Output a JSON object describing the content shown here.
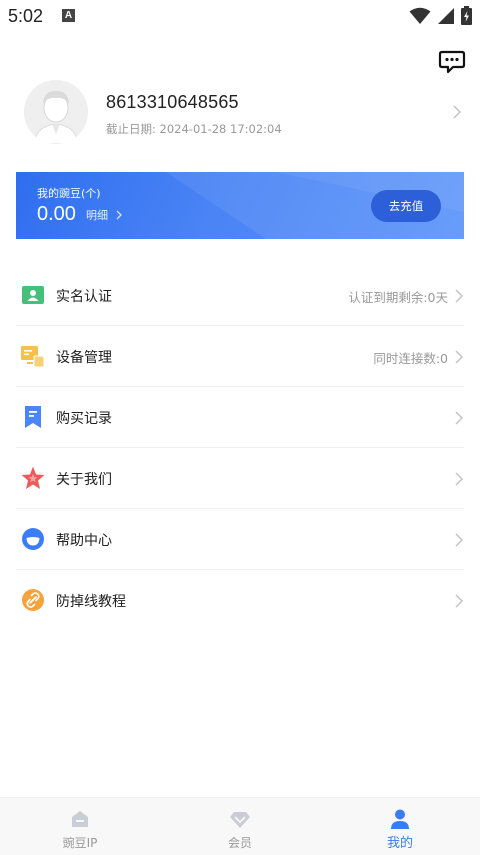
{
  "status": {
    "time": "5:02",
    "notification_icon_letter": "A"
  },
  "header": {
    "chat_icon": "chat-bubble-icon"
  },
  "profile": {
    "phone": "8613310648565",
    "expiry_label": "截止日期:",
    "expiry_value": "2024-01-28 17:02:04"
  },
  "bean_card": {
    "label": "我的豌豆(个)",
    "amount": "0.00",
    "detail_label": "明细",
    "recharge_label": "去充值"
  },
  "menu": {
    "items": [
      {
        "label": "实名认证",
        "value": "认证到期剩余:0天",
        "icon": "id-card-icon",
        "color": "#45c07a"
      },
      {
        "label": "设备管理",
        "value": "同时连接数:0",
        "icon": "devices-icon",
        "color": "#f5c14a"
      },
      {
        "label": "购买记录",
        "value": "",
        "icon": "bookmark-list-icon",
        "color": "#4a86f7"
      },
      {
        "label": "关于我们",
        "value": "",
        "icon": "star-icon",
        "color": "#ee5a5a"
      },
      {
        "label": "帮助中心",
        "value": "",
        "icon": "help-face-icon",
        "color": "#3b7df5"
      },
      {
        "label": "防掉线教程",
        "value": "",
        "icon": "link-icon",
        "color": "#f5a23c"
      }
    ]
  },
  "tabs": [
    {
      "label": "豌豆IP",
      "icon": "home-icon",
      "active": false
    },
    {
      "label": "会员",
      "icon": "diamond-icon",
      "active": false
    },
    {
      "label": "我的",
      "icon": "person-icon",
      "active": true
    }
  ],
  "colors": {
    "accent": "#3a7cf5",
    "card_start": "#2f6ef0",
    "card_end": "#5d96fa"
  }
}
